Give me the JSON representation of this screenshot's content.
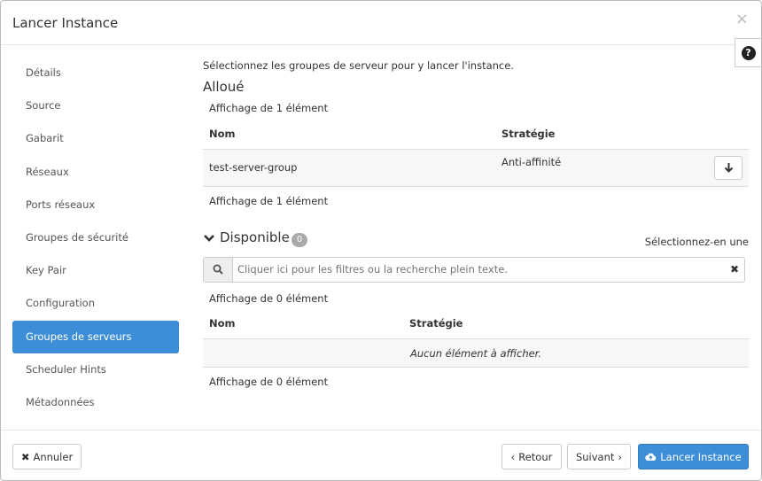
{
  "dialog": {
    "title": "Lancer Instance",
    "close_glyph": "×",
    "help_glyph": "?"
  },
  "sidebar": {
    "items": [
      {
        "label": "Détails"
      },
      {
        "label": "Source"
      },
      {
        "label": "Gabarit"
      },
      {
        "label": "Réseaux"
      },
      {
        "label": "Ports réseaux"
      },
      {
        "label": "Groupes de sécurité"
      },
      {
        "label": "Key Pair"
      },
      {
        "label": "Configuration"
      },
      {
        "label": "Groupes de serveurs"
      },
      {
        "label": "Scheduler Hints"
      },
      {
        "label": "Métadonnées"
      }
    ],
    "active_index": 8
  },
  "content": {
    "intro": "Sélectionnez les groupes de serveur pour y lancer l'instance.",
    "allocated": {
      "title": "Alloué",
      "count_top": "Affichage de 1 élément",
      "count_bottom": "Affichage de 1 élément",
      "columns": [
        "Nom",
        "Stratégie"
      ],
      "rows": [
        {
          "name": "test-server-group",
          "policy": "Anti-affinité"
        }
      ]
    },
    "available": {
      "title": "Disponible",
      "badge": "0",
      "select_one": "Sélectionnez-en une",
      "search_placeholder": "Cliquer ici pour les filtres ou la recherche plein texte.",
      "count_top": "Affichage de 0 élément",
      "count_bottom": "Affichage de 0 élément",
      "columns": [
        "Nom",
        "Stratégie"
      ],
      "empty": "Aucun élément à afficher."
    }
  },
  "footer": {
    "cancel": "Annuler",
    "back": "Retour",
    "next": "Suivant",
    "launch": "Lancer Instance"
  },
  "colors": {
    "accent": "#3d8ed6"
  }
}
